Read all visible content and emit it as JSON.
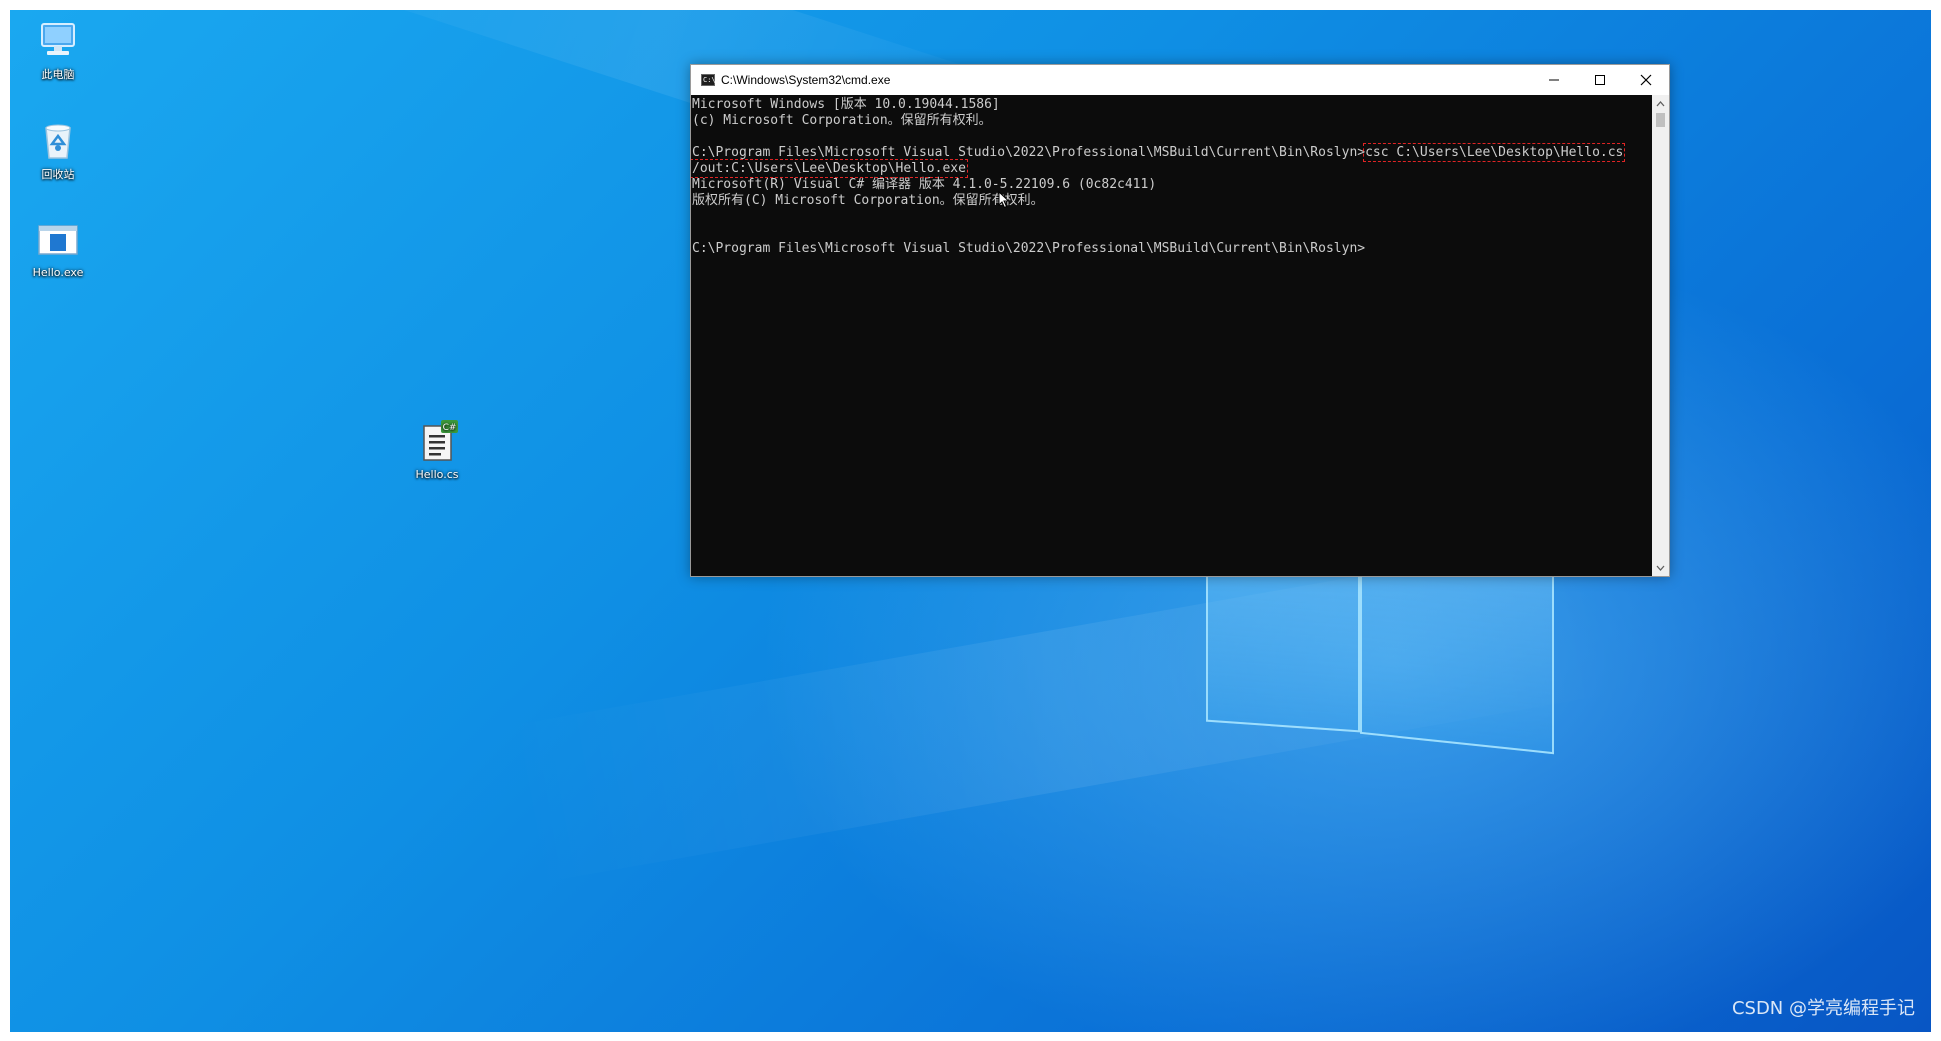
{
  "desktop": {
    "icons": [
      {
        "label": "此电脑",
        "icon": "computer-icon"
      },
      {
        "label": "回收站",
        "icon": "recycle-bin-icon"
      },
      {
        "label": "Hello.exe",
        "icon": "exe-file-icon"
      },
      {
        "label": "Hello.cs",
        "icon": "csharp-file-icon"
      }
    ]
  },
  "cmd_window": {
    "title": "C:\\Windows\\System32\\cmd.exe",
    "app_icon_text": "C:\\",
    "lines": [
      "Microsoft Windows [版本 10.0.19044.1586]",
      "(c) Microsoft Corporation。保留所有权利。",
      "",
      "C:\\Program Files\\Microsoft Visual Studio\\2022\\Professional\\MSBuild\\Current\\Bin\\Roslyn>",
      "csc C:\\Users\\Lee\\Desktop\\Hello.cs",
      "/out:C:\\Users\\Lee\\Desktop\\Hello.exe",
      "Microsoft(R) Visual C# 编译器 版本 4.1.0-5.22109.6 (0c82c411)",
      "版权所有(C) Microsoft Corporation。保留所有权利。",
      "",
      "",
      "C:\\Program Files\\Microsoft Visual Studio\\2022\\Professional\\MSBuild\\Current\\Bin\\Roslyn>"
    ]
  },
  "watermark": "CSDN @学亮编程手记",
  "colors": {
    "console_bg": "#0c0c0c",
    "console_text": "#cccccc",
    "highlight_box": "#e02424",
    "desktop_blue": "#0f8fe4"
  }
}
